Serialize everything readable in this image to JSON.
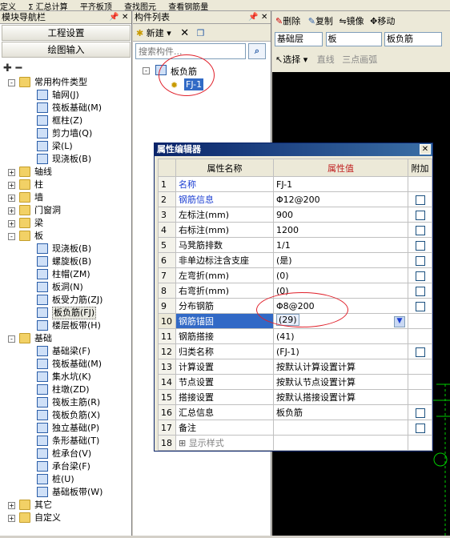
{
  "topbar": {
    "items": [
      "定义",
      "Σ 汇总计算",
      "平齐板顶",
      "查找图元",
      "查看钢筋量"
    ]
  },
  "nav": {
    "title": "模块导航栏",
    "buttons": [
      "工程设置",
      "绘图输入"
    ],
    "tree": [
      {
        "l": 0,
        "t": "常用构件类型",
        "ex": "-",
        "k": "folder"
      },
      {
        "l": 1,
        "t": "轴网(J)",
        "k": "comp"
      },
      {
        "l": 1,
        "t": "筏板基础(M)",
        "k": "comp"
      },
      {
        "l": 1,
        "t": "框柱(Z)",
        "k": "comp"
      },
      {
        "l": 1,
        "t": "剪力墙(Q)",
        "k": "comp"
      },
      {
        "l": 1,
        "t": "梁(L)",
        "k": "comp"
      },
      {
        "l": 1,
        "t": "现浇板(B)",
        "k": "comp"
      },
      {
        "l": 0,
        "t": "轴线",
        "ex": "+",
        "k": "folder"
      },
      {
        "l": 0,
        "t": "柱",
        "ex": "+",
        "k": "folder"
      },
      {
        "l": 0,
        "t": "墙",
        "ex": "+",
        "k": "folder"
      },
      {
        "l": 0,
        "t": "门窗洞",
        "ex": "+",
        "k": "folder"
      },
      {
        "l": 0,
        "t": "梁",
        "ex": "+",
        "k": "folder"
      },
      {
        "l": 0,
        "t": "板",
        "ex": "-",
        "k": "folder"
      },
      {
        "l": 1,
        "t": "现浇板(B)",
        "k": "comp"
      },
      {
        "l": 1,
        "t": "螺旋板(B)",
        "k": "comp"
      },
      {
        "l": 1,
        "t": "柱帽(ZM)",
        "k": "comp"
      },
      {
        "l": 1,
        "t": "板洞(N)",
        "k": "comp"
      },
      {
        "l": 1,
        "t": "板受力筋(ZJ)",
        "k": "comp"
      },
      {
        "l": 1,
        "t": "板负筋(FJ)",
        "k": "comp",
        "sel": true
      },
      {
        "l": 1,
        "t": "楼层板带(H)",
        "k": "comp"
      },
      {
        "l": 0,
        "t": "基础",
        "ex": "-",
        "k": "folder"
      },
      {
        "l": 1,
        "t": "基础梁(F)",
        "k": "comp"
      },
      {
        "l": 1,
        "t": "筏板基础(M)",
        "k": "comp"
      },
      {
        "l": 1,
        "t": "集水坑(K)",
        "k": "comp"
      },
      {
        "l": 1,
        "t": "柱墩(ZD)",
        "k": "comp"
      },
      {
        "l": 1,
        "t": "筏板主筋(R)",
        "k": "comp"
      },
      {
        "l": 1,
        "t": "筏板负筋(X)",
        "k": "comp"
      },
      {
        "l": 1,
        "t": "独立基础(P)",
        "k": "comp"
      },
      {
        "l": 1,
        "t": "条形基础(T)",
        "k": "comp"
      },
      {
        "l": 1,
        "t": "桩承台(V)",
        "k": "comp"
      },
      {
        "l": 1,
        "t": "承台梁(F)",
        "k": "comp"
      },
      {
        "l": 1,
        "t": "桩(U)",
        "k": "comp"
      },
      {
        "l": 1,
        "t": "基础板带(W)",
        "k": "comp"
      },
      {
        "l": 0,
        "t": "其它",
        "ex": "+",
        "k": "folder"
      },
      {
        "l": 0,
        "t": "自定义",
        "ex": "+",
        "k": "folder"
      }
    ]
  },
  "list": {
    "title": "构件列表",
    "new_label": "新建",
    "search_placeholder": "搜索构件...",
    "group": "板负筋",
    "item": "FJ-1"
  },
  "right": {
    "tools": [
      "删除",
      "复制",
      "镜像",
      "移动"
    ],
    "layer": "基础层",
    "type": "板",
    "subtype": "板负筋",
    "select": "选择",
    "line": "直线",
    "arc": "三点画弧"
  },
  "dialog": {
    "title": "属性编辑器",
    "headers": [
      "属性名称",
      "属性值",
      "附加"
    ],
    "rows": [
      {
        "n": "1",
        "name": "名称",
        "value": "FJ-1",
        "blue": true,
        "cb": false
      },
      {
        "n": "2",
        "name": "钢筋信息",
        "value": "Φ12@200",
        "blue": true,
        "cb": true
      },
      {
        "n": "3",
        "name": "左标注(mm)",
        "value": "900",
        "cb": true
      },
      {
        "n": "4",
        "name": "右标注(mm)",
        "value": "1200",
        "cb": true
      },
      {
        "n": "5",
        "name": "马凳筋排数",
        "value": "1/1",
        "cb": true
      },
      {
        "n": "6",
        "name": "非单边标注含支座",
        "value": "(是)",
        "cb": true
      },
      {
        "n": "7",
        "name": "左弯折(mm)",
        "value": "(0)",
        "cb": true
      },
      {
        "n": "8",
        "name": "右弯折(mm)",
        "value": "(0)",
        "cb": true
      },
      {
        "n": "9",
        "name": "分布钢筋",
        "value": "Φ8@200",
        "cb": true
      },
      {
        "n": "10",
        "name": "钢筋锚固",
        "value": "(29)",
        "cb": false,
        "hl": true
      },
      {
        "n": "11",
        "name": "钢筋搭接",
        "value": "(41)",
        "cb": false
      },
      {
        "n": "12",
        "name": "归类名称",
        "value": "(FJ-1)",
        "cb": true
      },
      {
        "n": "13",
        "name": "计算设置",
        "value": "按默认计算设置计算",
        "cb": false
      },
      {
        "n": "14",
        "name": "节点设置",
        "value": "按默认节点设置计算",
        "cb": false
      },
      {
        "n": "15",
        "name": "搭接设置",
        "value": "按默认搭接设置计算",
        "cb": false
      },
      {
        "n": "16",
        "name": "汇总信息",
        "value": "板负筋",
        "cb": true
      },
      {
        "n": "17",
        "name": "备注",
        "value": "",
        "cb": true
      },
      {
        "n": "18",
        "name": "显示样式",
        "value": "",
        "cb": false,
        "expand": true
      }
    ]
  }
}
